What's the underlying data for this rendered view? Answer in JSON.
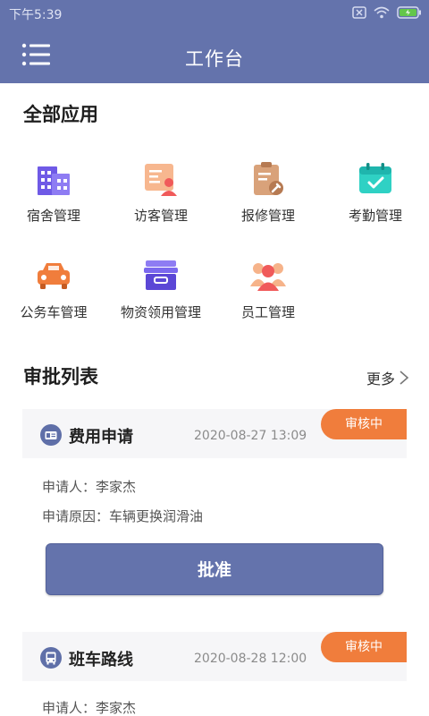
{
  "status_bar": {
    "time": "下午5:39"
  },
  "header": {
    "title": "工作台"
  },
  "apps_section": {
    "title": "全部应用",
    "items": [
      {
        "label": "宿舍管理",
        "icon": "building-icon"
      },
      {
        "label": "访客管理",
        "icon": "visitor-card-icon"
      },
      {
        "label": "报修管理",
        "icon": "repair-clipboard-icon"
      },
      {
        "label": "考勤管理",
        "icon": "calendar-check-icon"
      },
      {
        "label": "公务车管理",
        "icon": "car-icon"
      },
      {
        "label": "物资领用管理",
        "icon": "supply-box-icon"
      },
      {
        "label": "员工管理",
        "icon": "staff-group-icon"
      }
    ]
  },
  "approvals": {
    "title": "审批列表",
    "more_label": "更多",
    "cards": [
      {
        "title": "费用申请",
        "date": "2020-08-27 13:09",
        "status": "审核中",
        "applicant": "申请人：李家杰",
        "reason": "申请原因：车辆更换润滑油",
        "action_label": "批准",
        "icon": "expense-card-icon"
      },
      {
        "title": "班车路线",
        "date": "2020-08-28 12:00",
        "status": "审核中",
        "applicant": "申请人：李家杰",
        "icon": "bus-icon"
      }
    ]
  },
  "colors": {
    "primary": "#6473ac",
    "badge": "#f07d3c"
  }
}
